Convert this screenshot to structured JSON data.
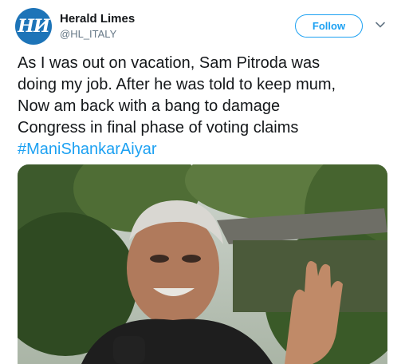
{
  "author": {
    "avatar_text": "НИ",
    "name": "Herald Limes",
    "handle": "@HL_ITALY"
  },
  "follow_label": "Follow",
  "tweet": {
    "lines": [
      "As I was out on vacation, Sam Pitroda was",
      "doing my job. After he was told to keep mum,",
      "Now am back with a bang to damage",
      "Congress in final phase of voting claims"
    ],
    "hashtag": "#ManiShankarAiyar"
  },
  "colors": {
    "accent": "#1da1f2",
    "text": "#14171a",
    "secondary": "#657786",
    "avatar_bg": "#1d74b8"
  },
  "icons": {
    "more": "chevron-down-icon"
  },
  "media": {
    "type": "photo"
  }
}
